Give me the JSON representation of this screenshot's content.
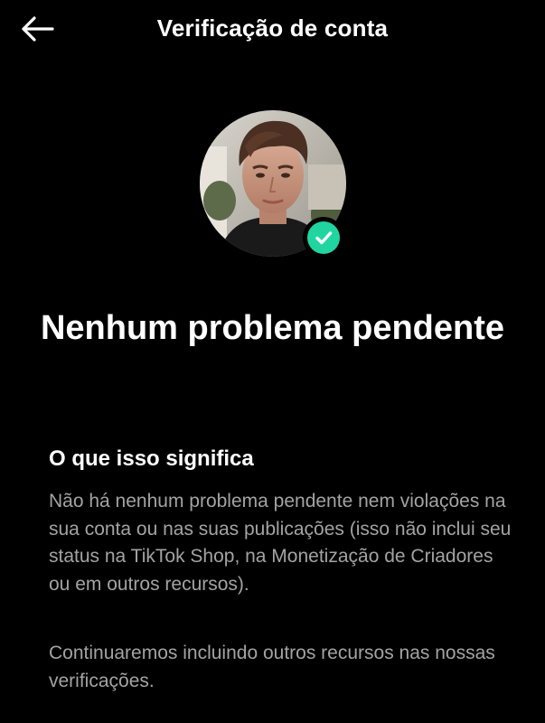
{
  "header": {
    "title": "Verificação de conta",
    "back_icon": "arrow-left-icon"
  },
  "profile": {
    "avatar_alt": "",
    "badge_icon": "checkmark-circle-icon",
    "badge_color": "#20D5A0"
  },
  "status": {
    "title": "Nenhum problema pendente"
  },
  "info": {
    "heading": "O que isso significa",
    "paragraph1": "Não há nenhum problema pendente nem violações na sua conta ou nas suas publicações (isso não inclui seu status na TikTok Shop, na Monetização de Criadores ou em outros recursos).",
    "paragraph2": "Continuaremos incluindo outros recursos nas nossas verificações."
  },
  "colors": {
    "background": "#000000",
    "text_primary": "#FFFFFF",
    "text_secondary": "#A3A3A3",
    "accent": "#20D5A0"
  }
}
